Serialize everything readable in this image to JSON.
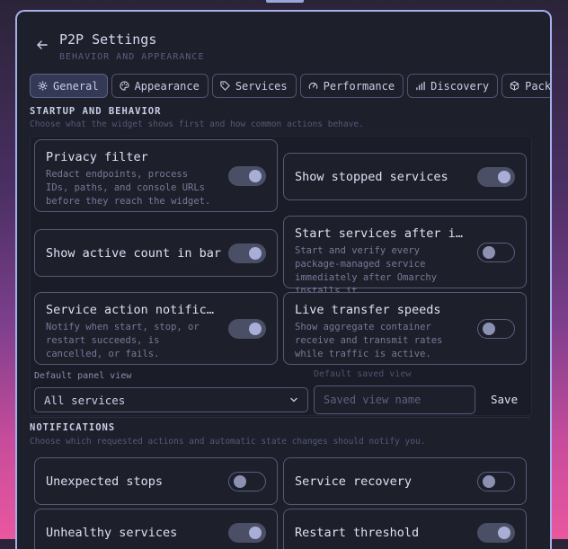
{
  "window": {
    "title": "P2P Settings",
    "subtitle": "BEHAVIOR AND APPEARANCE",
    "back_icon": "arrow-left-icon"
  },
  "tabs": [
    {
      "label": "General",
      "icon": "gear-icon",
      "active": true
    },
    {
      "label": "Appearance",
      "icon": "palette-icon",
      "active": false
    },
    {
      "label": "Services",
      "icon": "tag-icon",
      "active": false
    },
    {
      "label": "Performance",
      "icon": "gauge-icon",
      "active": false
    },
    {
      "label": "Discovery",
      "icon": "signal-bars-icon",
      "active": false
    },
    {
      "label": "Packages",
      "icon": "package-icon",
      "active": false
    }
  ],
  "startup": {
    "heading": "STARTUP AND BEHAVIOR",
    "description": "Choose what the widget shows first and how common actions behave.",
    "cards": [
      {
        "title": "Privacy filter",
        "description": "Redact endpoints, process IDs, paths, and console URLs before they reach the widget.",
        "enabled": true
      },
      {
        "title": "Show stopped services",
        "description": "",
        "enabled": true
      },
      {
        "title": "Show active count in bar",
        "description": "",
        "enabled": true
      },
      {
        "title": "Start services after in…",
        "description": "Start and verify every package-managed service immediately after Omarchy installs it.",
        "enabled": false
      },
      {
        "title": "Service action notifica…",
        "description": "Notify when start, stop, or restart succeeds, is cancelled, or fails.",
        "enabled": true
      },
      {
        "title": "Live transfer speeds",
        "description": "Show aggregate container receive and transmit rates while traffic is active.",
        "enabled": false
      }
    ],
    "default_panel_view": {
      "label": "Default panel view",
      "value": "All services"
    },
    "default_saved_view": {
      "label": "Default saved view",
      "placeholder": "Saved view name",
      "button": "Save"
    }
  },
  "notifications": {
    "heading": "NOTIFICATIONS",
    "description": "Choose which requested actions and automatic state changes should notify you.",
    "cards": [
      {
        "title": "Unexpected stops",
        "enabled": false
      },
      {
        "title": "Service recovery",
        "enabled": false
      },
      {
        "title": "Unhealthy services",
        "enabled": true
      },
      {
        "title": "Restart threshold",
        "enabled": true
      }
    ]
  },
  "colors": {
    "accent": "#a6aee8",
    "background": "#1d1f2b",
    "border": "#565a76"
  }
}
